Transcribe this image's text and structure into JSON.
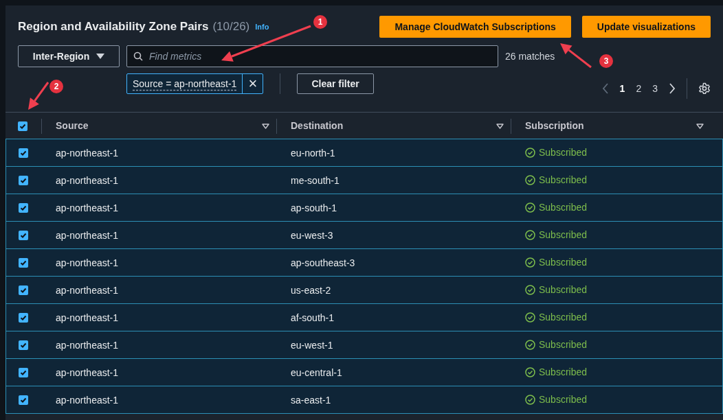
{
  "header": {
    "title": "Region and Availability Zone Pairs",
    "count": "(10/26)",
    "info_link": "Info"
  },
  "buttons": [
    "Manage CloudWatch Subscriptions",
    "Update visualizations"
  ],
  "scope_dropdown": {
    "value": "Inter-Region"
  },
  "search": {
    "placeholder": "Find metrics"
  },
  "match_count": "26 matches",
  "filter_token": {
    "label": "Source = ap-northeast-1",
    "remove": "×"
  },
  "clear_filter": "Clear filter",
  "pagination": {
    "prev_disabled": true,
    "pages": [
      {
        "label": "1",
        "selected": true
      },
      {
        "label": "2",
        "selected": false
      },
      {
        "label": "3",
        "selected": false
      }
    ]
  },
  "table": {
    "select_all_checked": true,
    "columns": [
      "Source",
      "Destination",
      "Subscription"
    ],
    "rows": [
      {
        "selected": true,
        "source": "ap-northeast-1",
        "destination": "eu-north-1",
        "subscription": "Subscribed"
      },
      {
        "selected": true,
        "source": "ap-northeast-1",
        "destination": "me-south-1",
        "subscription": "Subscribed"
      },
      {
        "selected": true,
        "source": "ap-northeast-1",
        "destination": "ap-south-1",
        "subscription": "Subscribed"
      },
      {
        "selected": true,
        "source": "ap-northeast-1",
        "destination": "eu-west-3",
        "subscription": "Subscribed"
      },
      {
        "selected": true,
        "source": "ap-northeast-1",
        "destination": "ap-southeast-3",
        "subscription": "Subscribed"
      },
      {
        "selected": true,
        "source": "ap-northeast-1",
        "destination": "us-east-2",
        "subscription": "Subscribed"
      },
      {
        "selected": true,
        "source": "ap-northeast-1",
        "destination": "af-south-1",
        "subscription": "Subscribed"
      },
      {
        "selected": true,
        "source": "ap-northeast-1",
        "destination": "eu-west-1",
        "subscription": "Subscribed"
      },
      {
        "selected": true,
        "source": "ap-northeast-1",
        "destination": "eu-central-1",
        "subscription": "Subscribed"
      },
      {
        "selected": true,
        "source": "ap-northeast-1",
        "destination": "sa-east-1",
        "subscription": "Subscribed"
      }
    ]
  },
  "annotations": [
    "1",
    "2",
    "3"
  ]
}
